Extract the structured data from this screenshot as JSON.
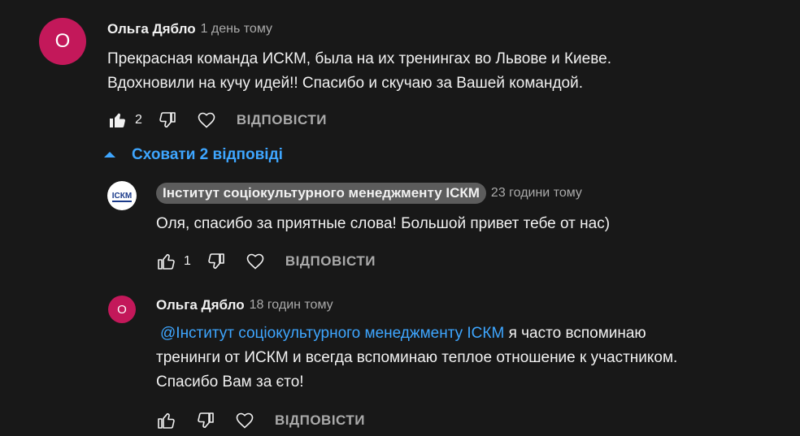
{
  "main_comment": {
    "avatar_letter": "О",
    "author": "Ольга Дябло",
    "time": "1 день тому",
    "text_line1": "Прекрасная команда ИСКМ, была на их тренингах во Львове и Киеве.",
    "text_line2": "Вдохновили на кучу идей!! Спасибо и скучаю за Вашей командой.",
    "like_count": "2",
    "reply_label": "ВІДПОВІСТИ"
  },
  "replies_toggle": {
    "label": "Сховати 2 відповіді"
  },
  "reply_1": {
    "avatar_logo_text": "ІСКМ",
    "author": "Інститут соціокультурного менеджменту ІСКМ",
    "time": "23 години тому",
    "text": "Оля, спасибо за приятные слова! Большой привет тебе от нас)",
    "like_count": "1",
    "reply_label": "ВІДПОВІСТИ"
  },
  "reply_2": {
    "avatar_letter": "О",
    "author": "Ольга Дябло",
    "time": "18 годин тому",
    "mention": "@Інститут соціокультурного менеджменту ІСКМ",
    "text_line1_rest": " я часто вспоминаю",
    "text_line2": "тренинги от ИСКМ и всегда вспоминаю теплое отношение к участником.",
    "text_line3": "Спасибо Вам за єто!",
    "reply_label": "ВІДПОВІСТИ"
  },
  "colors": {
    "background": "#181818",
    "avatar": "#c3185a",
    "link": "#3ea6ff",
    "muted": "#aaaaaa"
  }
}
